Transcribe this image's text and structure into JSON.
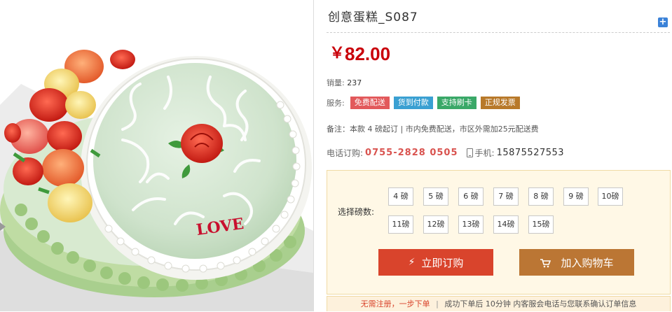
{
  "product": {
    "title": "创意蛋糕_S087",
    "price_currency": "￥",
    "price_value": "82.00",
    "sales_label": "销量:",
    "sales_value": "237",
    "services_label": "服务:",
    "services": [
      "免费配送",
      "货到付款",
      "支持刷卡",
      "正规发票"
    ],
    "note": "备注：本款 4 磅起订 | 市内免费配送，市区外需加25元配送费",
    "phone_label": "电话订购:",
    "phone_value": "0755-2828 0505",
    "mobile_label": "手机:",
    "mobile_value": "15875527553",
    "image_text": "LOVE"
  },
  "selector": {
    "label": "选择磅数:",
    "sizes": [
      "4 磅",
      "5 磅",
      "6 磅",
      "7 磅",
      "8 磅",
      "9 磅",
      "10磅",
      "11磅",
      "12磅",
      "13磅",
      "14磅",
      "15磅"
    ]
  },
  "actions": {
    "order_label": "立即订购",
    "cart_label": "加入购物车"
  },
  "footer": {
    "highlight": "无需注册，一步下单",
    "separator": "|",
    "rest": "成功下单后 10分钟 内客服会电话与您联系确认订单信息"
  },
  "colors": {
    "price": "#c9000a",
    "tag_free_delivery": "#e2595b",
    "tag_cod": "#3aa0d2",
    "tag_card": "#3aa868",
    "tag_invoice": "#b8792a",
    "order_button": "#d9442c",
    "cart_button": "#bb7634"
  },
  "icons": [
    "expand-icon",
    "mobile-phone-icon",
    "lightning-icon",
    "cart-icon"
  ]
}
